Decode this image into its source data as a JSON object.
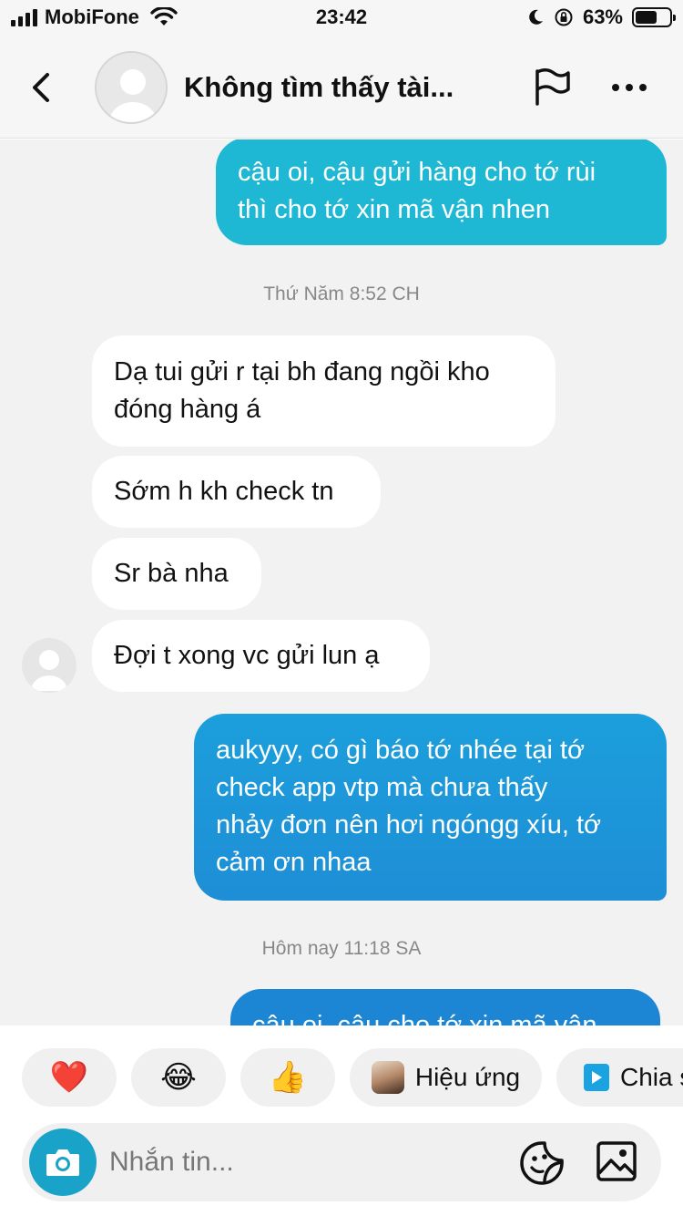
{
  "status_bar": {
    "carrier": "MobiFone",
    "time": "23:42",
    "battery_percent": "63%",
    "battery_level": 0.63,
    "icons": [
      "signal-icon",
      "wifi-icon",
      "moon-icon",
      "orientation-lock-icon",
      "battery-icon"
    ]
  },
  "header": {
    "title": "Không tìm thấy tài...",
    "icons": [
      "back-icon",
      "avatar",
      "flag-icon",
      "more-icon"
    ]
  },
  "messages": {
    "m1": {
      "line1": "cậu oi, cậu gửi hàng cho tớ rùi",
      "line2": "thì cho tớ xin mã vận nhen"
    },
    "ts1": "Thứ Năm 8:52 CH",
    "m2": {
      "line1": "Dạ tui gửi r tại bh đang ngồi kho",
      "line2": "đóng hàng á"
    },
    "m3": "Sớm h kh check tn",
    "m4": "Sr bà nha",
    "m5": "Đợi t xong vc gửi lun ạ",
    "m6": {
      "line1": "aukyyy, có gì báo tớ nhée tại tớ",
      "line2": "check app vtp mà chưa thấy",
      "line3": "nhảy đơn nên hơi ngóngg xíu, tớ",
      "line4": "cảm ơn nhaa"
    },
    "ts2": "Hôm nay 11:18 SA",
    "m7": "cậu oi, cậu cho tớ xin mã vận"
  },
  "reactions": {
    "heart": "❤️",
    "laugh": "😂",
    "thumbs": "👍",
    "effects_label": "Hiệu ứng",
    "share_label": "Chia s"
  },
  "input": {
    "placeholder": "Nhắn tin..."
  },
  "colors": {
    "outgoing_top": "#1fb6d6",
    "outgoing_bottom": "#1e8fd8",
    "camera": "#1aa3c9"
  }
}
